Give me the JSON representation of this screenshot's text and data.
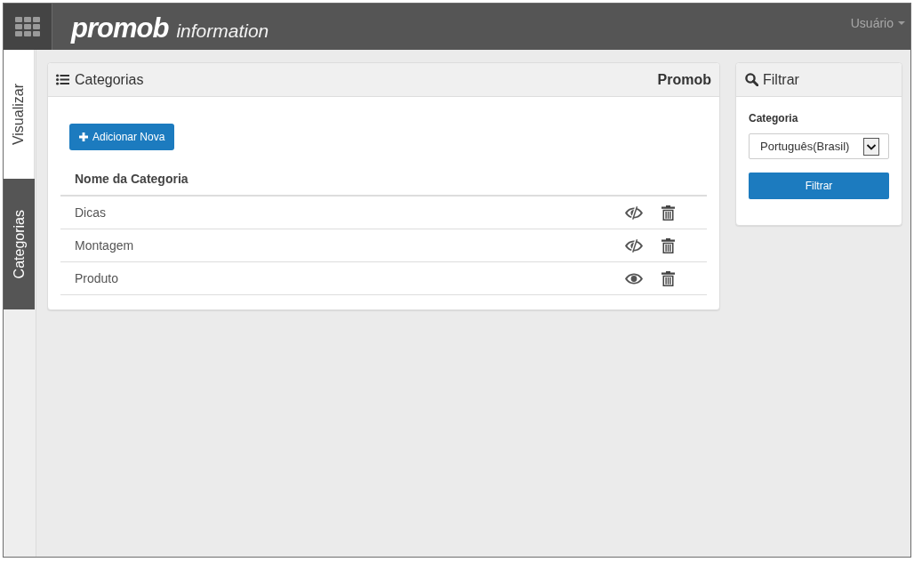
{
  "app_bar": {
    "logo_brand": "promob",
    "logo_product": "information",
    "user_menu": "Usuário"
  },
  "side_tabs": [
    {
      "label": "Visualizar",
      "selected": false
    },
    {
      "label": "Categorias",
      "selected": true
    }
  ],
  "categories_panel": {
    "title": "Categorias",
    "brand": "Promob",
    "add_button": "Adicionar Nova",
    "table": {
      "columns": [
        "Nome da Categoria"
      ],
      "rows": [
        {
          "name": "Dicas",
          "visible": false
        },
        {
          "name": "Montagem",
          "visible": false
        },
        {
          "name": "Produto",
          "visible": true
        }
      ]
    }
  },
  "filter_panel": {
    "title": "Filtrar",
    "field_label": "Categoria",
    "select_value": "Português(Brasil)",
    "button": "Filtrar"
  }
}
